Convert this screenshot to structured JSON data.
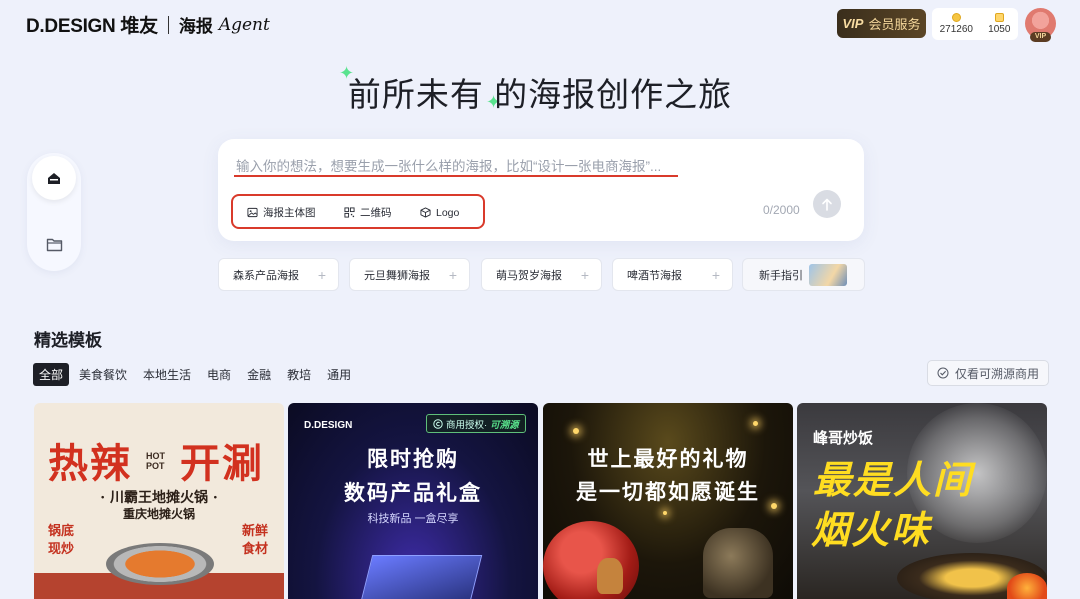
{
  "header": {
    "brand": "D.DESIGN 堆友",
    "product": "海报",
    "agent": "Agent",
    "vip_mark": "VIP",
    "vip_label": "会员服务",
    "credit1": "271260",
    "credit2": "1050",
    "avatar_tag": "VIP"
  },
  "hero": {
    "title_part1": "前所未有",
    "title_part2": "的海报创作之旅"
  },
  "prompt": {
    "placeholder": "输入你的想法，想要生成一张什么样的海报，比如“设计一张电商海报”...",
    "tool_poster_subject": "海报主体图",
    "tool_qrcode": "二维码",
    "tool_logo": "Logo",
    "counter": "0/2000"
  },
  "chips": [
    {
      "label": "森系产品海报"
    },
    {
      "label": "元旦舞狮海报"
    },
    {
      "label": "萌马贺岁海报"
    },
    {
      "label": "啤酒节海报"
    }
  ],
  "guide_label": "新手指引",
  "section_title": "精选模板",
  "tabs": [
    "全部",
    "美食餐饮",
    "本地生活",
    "电商",
    "金融",
    "教培",
    "通用"
  ],
  "filter_label": "仅看可溯源商用",
  "cards": {
    "c1_title_a": "热辣",
    "c1_hot": "HOT",
    "c1_pot_word": "POT",
    "c1_title_b": "开涮",
    "c1_sub1": "· 川霸王地摊火锅 ·",
    "c1_sub2": "重庆地摊火锅",
    "c1_left": "锅底\n现炒",
    "c1_right": "新鲜\n食材",
    "c2_brand": "D.DESIGN",
    "c2_badge": "商用授权·",
    "c2_badge_em": "可溯源",
    "c2_t1": "限时抢购",
    "c2_t2": "数码产品礼盒",
    "c2_t3": "科技新品 一盒尽享",
    "c3_t1": "世上最好的礼物",
    "c3_t2": "是一切都如愿诞生",
    "c4_brand": "峰哥炒饭",
    "c4_t1": "最是人间",
    "c4_t2": "烟火味"
  },
  "colors": {
    "accent_red": "#d93a2b",
    "spark_green": "#59e38e",
    "vip_gold": "#f4d79b"
  }
}
